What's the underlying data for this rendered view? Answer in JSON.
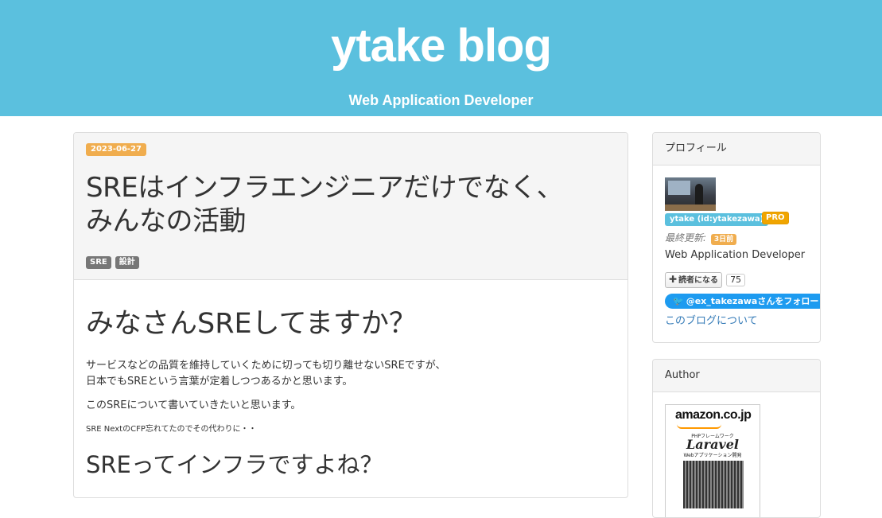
{
  "header": {
    "title": "ytake blog",
    "description": "Web Application Developer"
  },
  "article": {
    "date": "2023-06-27",
    "title_line1": "SREはインフラエンジニアだけでなく、",
    "title_line2": "みんなの活動",
    "categories": [
      "SRE",
      "設計"
    ],
    "heading1": "みなさんSREしてますか？",
    "paragraph1_line1": "サービスなどの品質を維持していくために切っても切り離せないSREですが、",
    "paragraph1_line2": "日本でもSREという言葉が定着しつつあるかと思います。",
    "paragraph2": "このSREについて書いていきたいと思います。",
    "paragraph3": "SRE NextのCFP忘れてたのでその代わりに・・",
    "heading2": "SREってインフラですよね？"
  },
  "profile": {
    "heading": "プロフィール",
    "user_id": "ytake (id:ytakezawa)",
    "pro_label": "PRO",
    "updated_label": "最終更新:",
    "updated_value": "3日前",
    "description": "Web Application Developer",
    "subscribe_label": "読者になる",
    "subscriber_count": "75",
    "twitter_label": "@ex_takezawaさんをフォロー",
    "about_link": "このブログについて"
  },
  "author": {
    "heading": "Author",
    "book_store": "amazon.co.jp",
    "book_subtitle": "PHPフレームワーク",
    "book_title": "Laravel",
    "book_title2": "Webアプリケーション開発"
  },
  "colors": {
    "header_bg": "#5bc0de",
    "date_badge": "#f0ad4e",
    "category_badge": "#777777",
    "link": "#337ab7",
    "twitter": "#1d9bf0"
  }
}
